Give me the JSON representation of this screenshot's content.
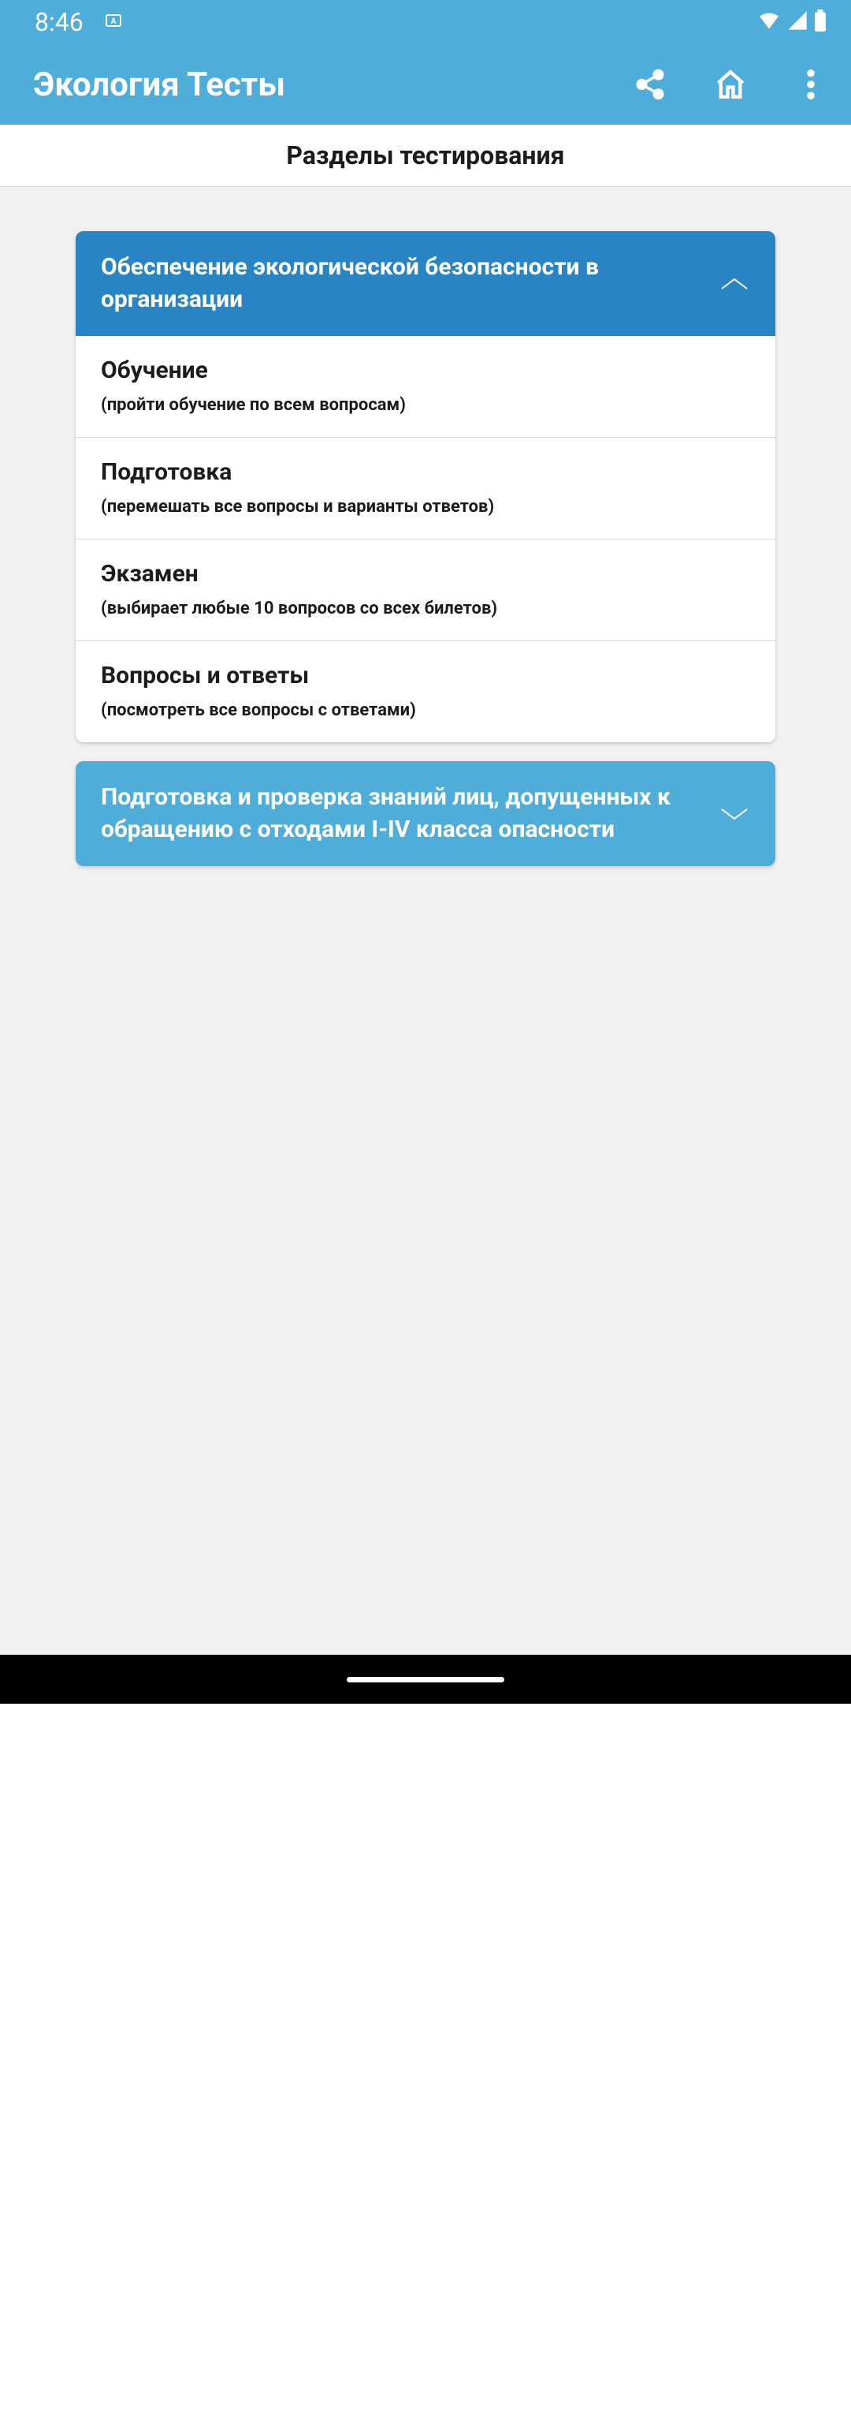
{
  "status": {
    "time": "8:46"
  },
  "app": {
    "title": "Экология Тесты"
  },
  "subtitle": "Разделы тестирования",
  "sections": [
    {
      "title": "Обеспечение экологической безопасности в организации",
      "items": [
        {
          "title": "Обучение",
          "subtitle": "(пройти обучение по всем вопросам)"
        },
        {
          "title": "Подготовка",
          "subtitle": "(перемешать все вопросы и варианты ответов)"
        },
        {
          "title": "Экзамен",
          "subtitle": "(выбирает любые 10 вопросов со всех билетов)"
        },
        {
          "title": "Вопросы и ответы",
          "subtitle": "(посмотреть все вопросы с ответами)"
        }
      ]
    },
    {
      "title": "Подготовка и проверка знаний лиц, допущенных к обращению с отходами I-IV класса опасности"
    }
  ]
}
